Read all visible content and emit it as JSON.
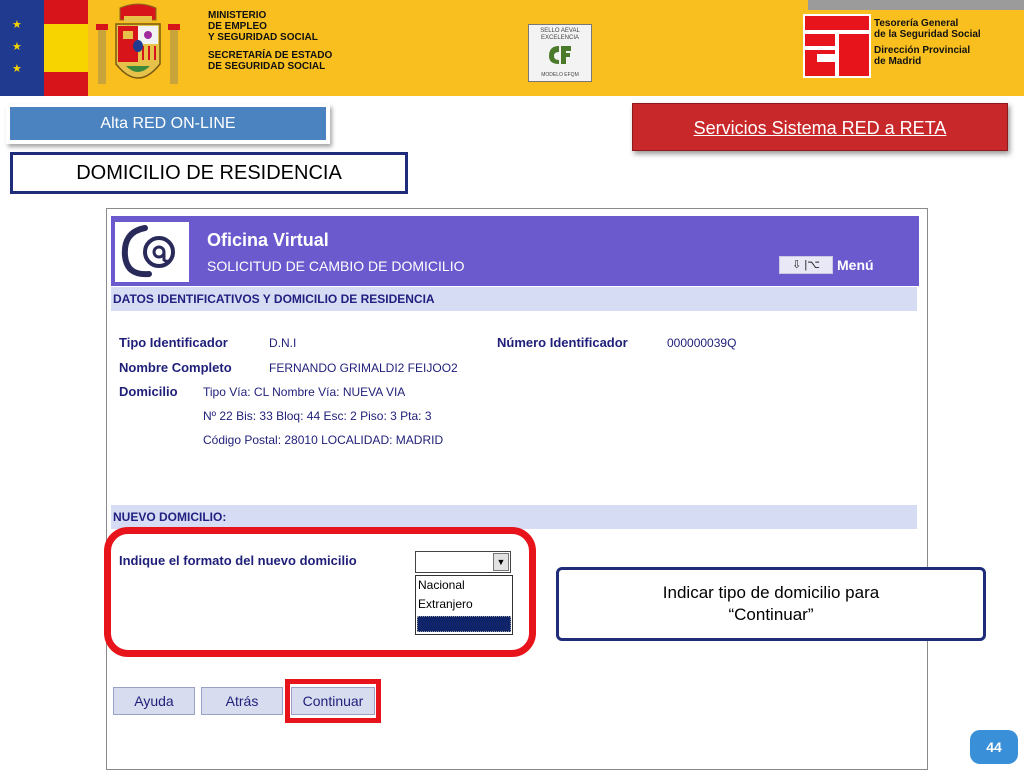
{
  "header": {
    "ministry_lines": [
      "MINISTERIO",
      "DE  EMPLEO",
      "Y SEGURIDAD SOCIAL"
    ],
    "secretary_lines": [
      "SECRETARÍA DE ESTADO",
      "DE SEGURIDAD SOCIAL"
    ],
    "seal_lines": [
      "SELLO AEVAL",
      "EXCELENCIA"
    ],
    "seal_footer": "MODELO EFQM",
    "tgss_lines": [
      "Tesorería General",
      "de la Seguridad Social"
    ],
    "direccion_lines": [
      "Dirección Provincial",
      "de Madrid"
    ]
  },
  "slide": {
    "alta_label": "Alta RED ON-LINE",
    "servicios_label": "Servicios Sistema RED a RETA",
    "section_title": "DOMICILIO DE RESIDENCIA",
    "callout_lines": [
      "Indicar tipo de domicilio para",
      "“Continuar”"
    ],
    "page_number": "44"
  },
  "app": {
    "title": "Oficina Virtual",
    "subtitle": "SOLICITUD DE CAMBIO DE DOMICILIO",
    "menu_label": "Menú",
    "section1": "DATOS IDENTIFICATIVOS Y DOMICILIO DE RESIDENCIA",
    "tipo_identificador_label": "Tipo Identificador",
    "tipo_identificador_value": "D.N.I",
    "numero_identificador_label": "Número Identificador",
    "numero_identificador_value": "000000039Q",
    "nombre_label": "Nombre Completo",
    "nombre_value": "FERNANDO GRIMALDI2 FEIJOO2",
    "domicilio_label": "Domicilio",
    "domicilio_lines": [
      "Tipo Vía: CL Nombre Vía: NUEVA VIA",
      "Nº 22 Bis: 33 Bloq: 44 Esc: 2 Piso: 3 Pta: 3",
      "Código Postal: 28010 LOCALIDAD: MADRID"
    ],
    "section2": "NUEVO DOMICILIO:",
    "formato_label": "Indique el formato del nuevo domicilio",
    "select_value": "",
    "select_options": [
      "Nacional",
      "Extranjero",
      ""
    ],
    "buttons": {
      "ayuda": "Ayuda",
      "atras": "Atrás",
      "continuar": "Continuar"
    }
  },
  "colors": {
    "header_yellow": "#f9bf1f",
    "app_purple": "#6a5acd",
    "highlight_red": "#e8141c",
    "label_navy": "#1f1f7a"
  }
}
